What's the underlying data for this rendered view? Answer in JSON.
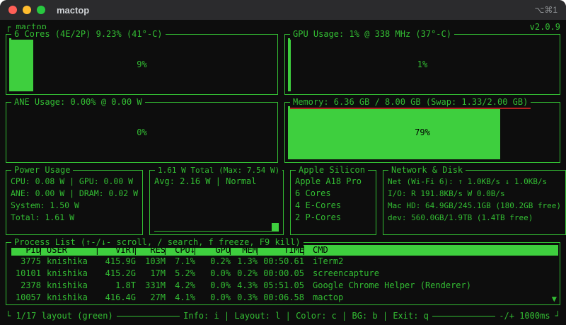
{
  "theme": {
    "bg": "#0d0d0d",
    "green": "#33bd33",
    "green-fill": "#3ecf3e",
    "red": "#b22020",
    "titlebar-bg": "#2b2b2d"
  },
  "titlebar": {
    "title": "mactop",
    "shortcut": "⌥⌘1"
  },
  "header": {
    "left": "┌ mactop",
    "version": "v2.0.9"
  },
  "gauges": {
    "cpu": {
      "title": "6 Cores (4E/2P) 9.23% (41°-C)",
      "label": "9%",
      "percent": 9
    },
    "gpu": {
      "title": "GPU Usage: 1% @ 338 MHz (37°-C)",
      "label": "1%",
      "percent": 1
    },
    "ane": {
      "title": "ANE Usage: 0.00% @ 0.00 W",
      "label": "0%",
      "percent": 0
    },
    "memory": {
      "title": "Memory: 6.36 GB / 8.00 GB (Swap: 1.33/2.00 GB)",
      "label": "79%",
      "percent": 79
    }
  },
  "power": {
    "title": "Power Usage",
    "lines": [
      "CPU: 0.08 W | GPU: 0.00 W",
      "ANE: 0.00 W | DRAM: 0.02 W",
      "System: 1.50 W",
      "Total: 1.61 W"
    ]
  },
  "power_total": {
    "title": "1.61 W Total (Max: 7.54 W)",
    "avg_line": "Avg: 2.16 W | Normal",
    "percent": 21
  },
  "silicon": {
    "title": "Apple Silicon",
    "lines": [
      "Apple A18 Pro",
      "6 Cores",
      "4 E-Cores",
      "2 P-Cores"
    ]
  },
  "network": {
    "title": "Network & Disk",
    "lines": [
      "Net (Wi-Fi 6): ↑ 1.0KB/s ↓ 1.0KB/s",
      "I/O: R 191.8KB/s W 0.0B/s",
      "Mac HD: 64.9GB/245.1GB (180.2GB free)",
      "dev: 560.0GB/1.9TB (1.4TB free)"
    ]
  },
  "processes": {
    "title": "Process List (↑-/↓- scroll, / search, f freeze, F9 kill)",
    "headers": [
      "PID",
      "USER",
      "VIRT",
      "RES",
      "CPU↓",
      "GPU",
      "MEM",
      "TIME",
      "CMD"
    ],
    "rows": [
      [
        "3775",
        "knishika",
        "415.9G",
        "103M",
        "7.1%",
        "0.2%",
        "1.3%",
        "00:50.61",
        "iTerm2"
      ],
      [
        "10101",
        "knishika",
        "415.2G",
        "17M",
        "5.2%",
        "0.0%",
        "0.2%",
        "00:00.05",
        "screencapture"
      ],
      [
        "2378",
        "knishika",
        "1.8T",
        "331M",
        "4.2%",
        "0.0%",
        "4.3%",
        "05:51.05",
        "Google Chrome Helper (Renderer)"
      ],
      [
        "10057",
        "knishika",
        "416.4G",
        "27M",
        "4.1%",
        "0.0%",
        "0.3%",
        "00:06.58",
        "mactop"
      ]
    ],
    "scroll_down_indicator": "▼"
  },
  "statusbar": {
    "left": "└ 1/17 layout (green)",
    "center": "Info: i | Layout: l | Color: c | BG: b | Exit: q",
    "right": "-/+ 1000ms ┘"
  }
}
